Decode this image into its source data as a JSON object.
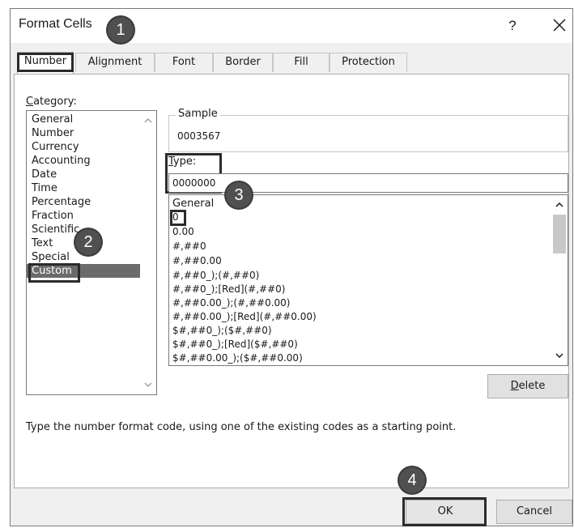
{
  "dialog": {
    "title": "Format Cells",
    "help": "?"
  },
  "tabs": [
    {
      "label": "Number",
      "active": true
    },
    {
      "label": "Alignment"
    },
    {
      "label": "Font"
    },
    {
      "label": "Border"
    },
    {
      "label": "Fill"
    },
    {
      "label": "Protection"
    }
  ],
  "category": {
    "label_underlined": "C",
    "label_rest": "ategory:",
    "items": [
      "General",
      "Number",
      "Currency",
      "Accounting",
      "Date",
      "Time",
      "Percentage",
      "Fraction",
      "Scientific",
      "Text",
      "Special",
      "Custom"
    ],
    "selected": "Custom"
  },
  "sample": {
    "legend": "Sample",
    "value": "0003567"
  },
  "type": {
    "label_underlined": "T",
    "label_rest": "ype:",
    "value": "0000000"
  },
  "formats": [
    "General",
    "0",
    "0.00",
    "#,##0",
    "#,##0.00",
    "#,##0_);(#,##0)",
    "#,##0_);[Red](#,##0)",
    "#,##0.00_);(#,##0.00)",
    "#,##0.00_);[Red](#,##0.00)",
    "$#,##0_);($#,##0)",
    "$#,##0_);[Red]($#,##0)",
    "$#,##0.00_);($#,##0.00)"
  ],
  "buttons": {
    "delete_underlined": "D",
    "delete_rest": "elete",
    "ok": "OK",
    "cancel": "Cancel"
  },
  "hint": "Type the number format code, using one of the existing codes as a starting point.",
  "callouts": [
    "1",
    "2",
    "3",
    "4"
  ],
  "colors": {
    "dialog_bg": "#f0f0f0",
    "selection": "#6b6b6b",
    "callout": "#505050",
    "highlight_border": "#2b2b2b"
  }
}
